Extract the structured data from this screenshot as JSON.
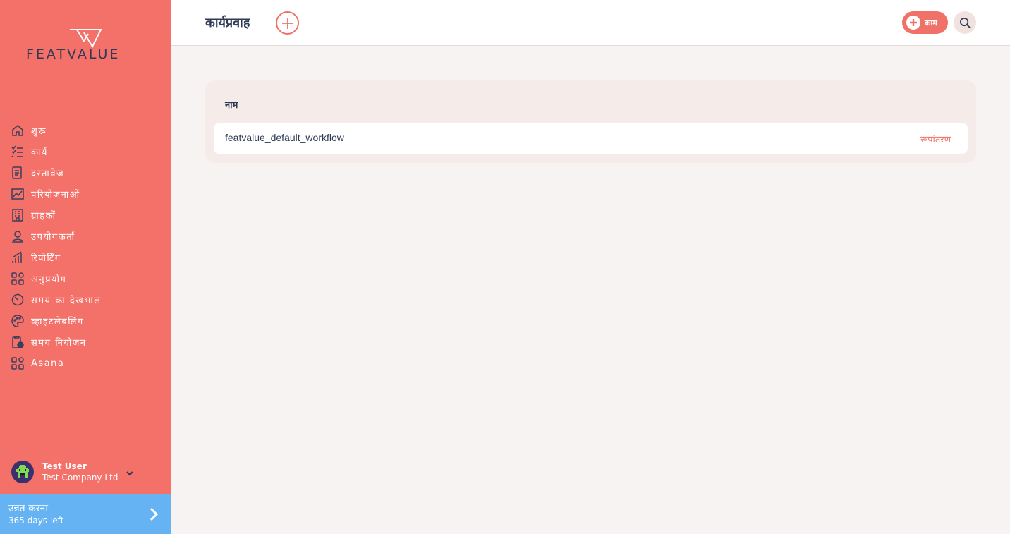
{
  "brand": {
    "name": "FEATVALUE",
    "accent": "#f4716a",
    "dark": "#2f3a56",
    "upgrade_color": "#66b3f3"
  },
  "sidebar": {
    "items": [
      {
        "label": "शुरू",
        "icon": "home-icon"
      },
      {
        "label": "कार्य",
        "icon": "checklist-icon"
      },
      {
        "label": "दस्तावेज",
        "icon": "document-icon"
      },
      {
        "label": "परियोजनाओं",
        "icon": "chart-icon"
      },
      {
        "label": "ग्राहकों",
        "icon": "building-icon"
      },
      {
        "label": "उपयोगकर्ता",
        "icon": "user-icon"
      },
      {
        "label": "रिपोर्टिंग",
        "icon": "bar-chart-icon"
      },
      {
        "label": "अनुप्रयोग",
        "icon": "apps-icon"
      },
      {
        "label": "समय का देखभाल",
        "icon": "timer-icon"
      },
      {
        "label": "व्हाइटलेबलिंग",
        "icon": "palette-icon"
      },
      {
        "label": "समय नियोजन",
        "icon": "schedule-icon"
      },
      {
        "label": "Asana",
        "icon": "apps-icon"
      }
    ],
    "user": {
      "name": "Test User",
      "company": "Test Company Ltd"
    },
    "upgrade": {
      "title": "उन्नत करना",
      "subtitle": "365 days left"
    }
  },
  "header": {
    "title": "कार्यप्रवाह",
    "task_button_label": "काम"
  },
  "table": {
    "column_header": "नाम",
    "rows": [
      {
        "name": "featvalue_default_workflow",
        "action": "रूपांतरण"
      }
    ]
  }
}
